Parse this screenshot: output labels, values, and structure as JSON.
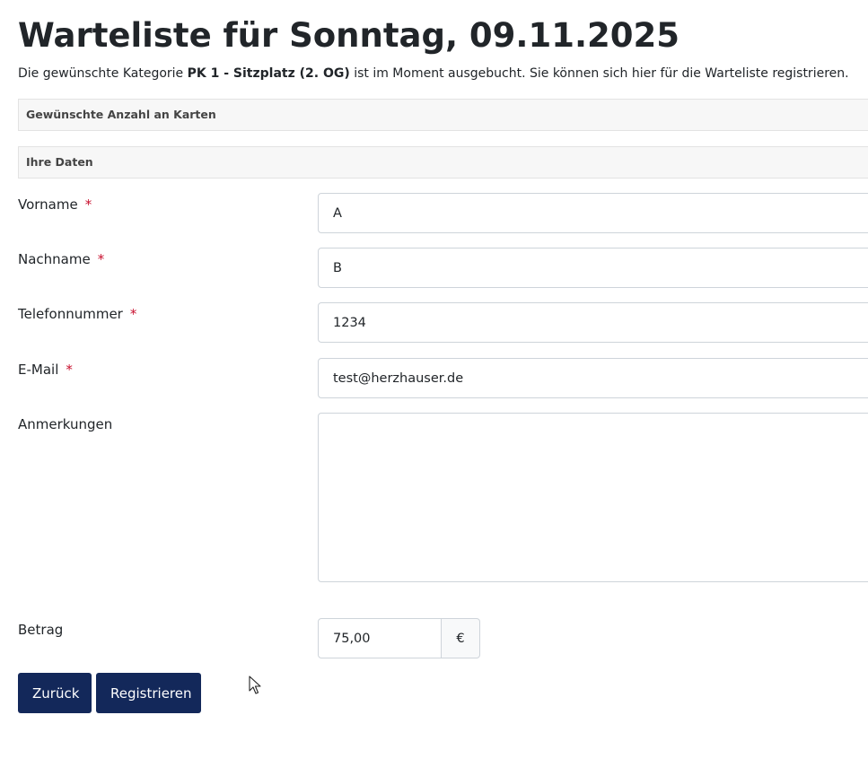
{
  "page": {
    "title": "Warteliste für Sonntag, 09.11.2025",
    "intro_before": "Die gewünschte Kategorie ",
    "intro_category": "PK 1 - Sitzplatz (2. OG)",
    "intro_after": " ist im Moment ausgebucht. Sie können sich hier für die Warteliste registrieren."
  },
  "sections": {
    "tickets_header": "Gewünschte Anzahl an Karten",
    "personal_header": "Ihre Daten"
  },
  "form": {
    "required_marker": "*",
    "firstname": {
      "label": "Vorname",
      "value": "A"
    },
    "lastname": {
      "label": "Nachname",
      "value": "B"
    },
    "phone": {
      "label": "Telefonnummer",
      "value": "1234"
    },
    "email": {
      "label": "E-Mail",
      "value": "test@herzhauser.de"
    },
    "remarks": {
      "label": "Anmerkungen",
      "value": ""
    },
    "amount": {
      "label": "Betrag",
      "value": "75,00",
      "currency": "€"
    }
  },
  "buttons": {
    "back": "Zurück",
    "register": "Registrieren"
  },
  "colors": {
    "button_bg": "#13285a",
    "required": "#c8102e",
    "section_bg": "#f7f7f7"
  },
  "icons": {
    "cursor": "mouse-pointer-icon"
  }
}
